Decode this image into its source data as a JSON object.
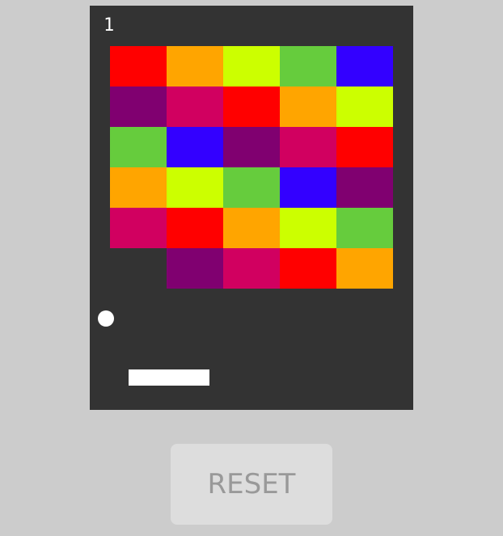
{
  "score": "1",
  "reset_label": "RESET",
  "colors": {
    "board_background": "#333333",
    "page_background": "#cccccc",
    "ball": "#ffffff",
    "paddle": "#ffffff",
    "reset_background": "#dddddd",
    "reset_text": "#999999"
  },
  "palette": {
    "red": "#ff0000",
    "orange": "#ffa500",
    "lime": "#ccff00",
    "green": "#66cc3d",
    "blue": "#3300ff",
    "purple": "#800070",
    "magenta": "#d10060"
  },
  "bricks": [
    [
      "red",
      "orange",
      "lime",
      "green",
      "blue"
    ],
    [
      "purple",
      "magenta",
      "red",
      "orange",
      "lime"
    ],
    [
      "green",
      "blue",
      "purple",
      "magenta",
      "red"
    ],
    [
      "orange",
      "lime",
      "green",
      "blue",
      "purple"
    ],
    [
      "magenta",
      "red",
      "orange",
      "lime",
      "green"
    ],
    [
      null,
      "purple",
      "magenta",
      "red",
      "orange"
    ]
  ]
}
